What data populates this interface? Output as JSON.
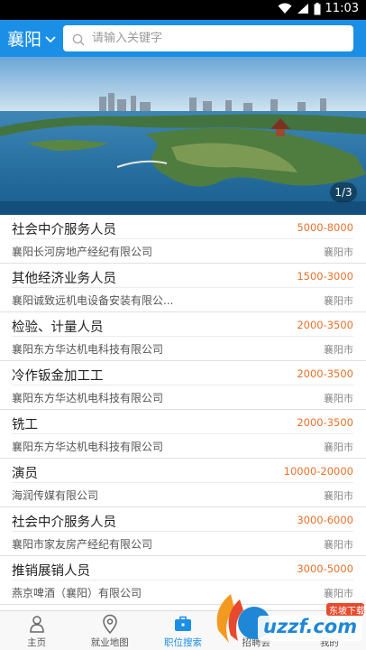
{
  "status_bar": {
    "time": "11:03"
  },
  "header": {
    "city": "襄阳",
    "search_placeholder": "请输入关键字"
  },
  "banner": {
    "page_indicator": "1/3"
  },
  "jobs": [
    {
      "title": "社会中介服务人员",
      "salary": "5000-8000",
      "company": "襄阳长河房地产经纪有限公司",
      "location": "襄阳市"
    },
    {
      "title": "其他经济业务人员",
      "salary": "1500-3000",
      "company": "襄阳诚致远机电设备安装有限公...",
      "location": "襄阳市"
    },
    {
      "title": "检验、计量人员",
      "salary": "2000-3500",
      "company": "襄阳东方华达机电科技有限公司",
      "location": "襄阳市"
    },
    {
      "title": "冷作钣金加工工",
      "salary": "2000-3500",
      "company": "襄阳东方华达机电科技有限公司",
      "location": "襄阳市"
    },
    {
      "title": "铣工",
      "salary": "2000-3500",
      "company": "襄阳东方华达机电科技有限公司",
      "location": "襄阳市"
    },
    {
      "title": "演员",
      "salary": "10000-20000",
      "company": "海润传媒有限公司",
      "location": "襄阳市"
    },
    {
      "title": "社会中介服务人员",
      "salary": "3000-6000",
      "company": "襄阳市家友房产经纪有限公司",
      "location": "襄阳市"
    },
    {
      "title": "推销展销人员",
      "salary": "3000-5000",
      "company": "燕京啤酒（襄阳）有限公司",
      "location": "襄阳市"
    }
  ],
  "tabs": [
    {
      "label": "主页",
      "icon": "home-person-icon",
      "active": false
    },
    {
      "label": "就业地图",
      "icon": "map-pin-icon",
      "active": false
    },
    {
      "label": "职位搜索",
      "icon": "briefcase-icon",
      "active": true
    },
    {
      "label": "招聘会",
      "icon": "recruitment-icon",
      "active": false
    },
    {
      "label": "我的",
      "icon": "profile-icon",
      "active": false
    }
  ],
  "watermark": {
    "text": "uzzf.com",
    "subtext": "东坡下载"
  },
  "colors": {
    "brand": "#1b8fe6",
    "salary": "#e6722e"
  }
}
